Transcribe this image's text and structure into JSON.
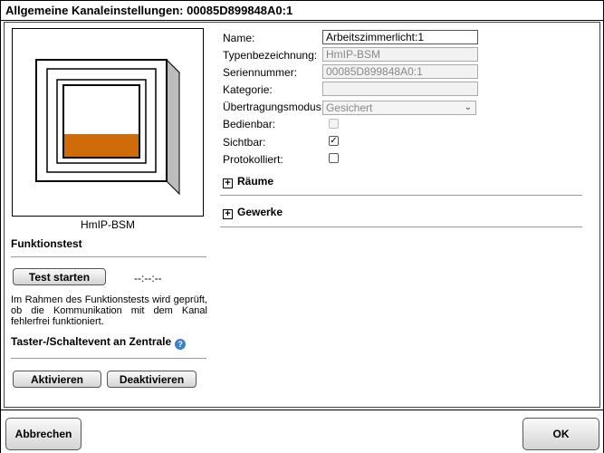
{
  "window": {
    "title": "Allgemeine Kanaleinstellungen: 00085D899848A0:1"
  },
  "device": {
    "name": "HmIP-BSM",
    "image_icon": "wall-switch-actuator-icon",
    "accent_color": "#d06b0a"
  },
  "funktionstest": {
    "title": "Funktionstest",
    "start_label": "Test starten",
    "status": "--:--:--",
    "description": "Im Rahmen des Funktionstests wird geprüft, ob die Kommunikation mit dem Kanal fehlerfrei funktioniert."
  },
  "taster": {
    "title": "Taster-/Schaltevent an Zentrale",
    "help_icon": "help-icon",
    "help_glyph": "?",
    "activate_label": "Aktivieren",
    "deactivate_label": "Deaktivieren"
  },
  "form": {
    "name_label": "Name:",
    "name_value": "Arbeitszimmerlicht:1",
    "type_label": "Typenbezeichnung:",
    "type_value": "HmIP-BSM",
    "serial_label": "Seriennummer:",
    "serial_value": "00085D899848A0:1",
    "category_label": "Kategorie:",
    "category_value": "",
    "mode_label": "Übertragungsmodus:",
    "mode_value": "Gesichert",
    "operable_label": "Bedienbar:",
    "operable_checked": false,
    "visible_label": "Sichtbar:",
    "visible_checked": true,
    "logged_label": "Protokolliert:",
    "logged_checked": false,
    "check_glyph": "✓"
  },
  "sections": {
    "rooms_label": "Räume",
    "trades_label": "Gewerke",
    "expand_glyph": "+"
  },
  "footer": {
    "cancel_label": "Abbrechen",
    "ok_label": "OK"
  }
}
